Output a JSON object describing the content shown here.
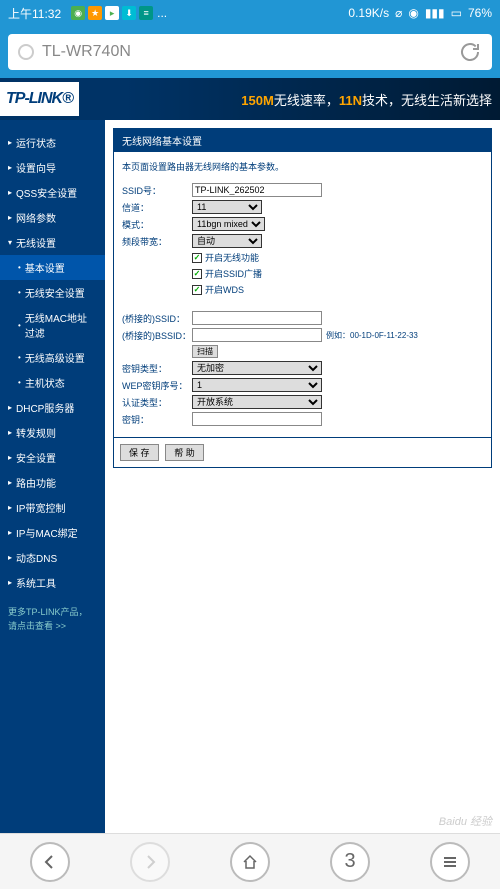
{
  "status": {
    "time": "上午11:32",
    "dots": "...",
    "speed": "0.19K/s",
    "battery": "76%"
  },
  "url": {
    "text": "TL-WR740N"
  },
  "banner": {
    "logo": "TP-LINK®",
    "slogan_hl1": "150M",
    "slogan_1": "无线速率，",
    "slogan_hl2": "11N",
    "slogan_2": "技术，无线生活新选择"
  },
  "nav": {
    "items": [
      {
        "label": "运行状态",
        "sub": false
      },
      {
        "label": "设置向导",
        "sub": false
      },
      {
        "label": "QSS安全设置",
        "sub": false
      },
      {
        "label": "网络参数",
        "sub": false
      },
      {
        "label": "无线设置",
        "sub": false,
        "expanded": true
      },
      {
        "label": "基本设置",
        "sub": true,
        "active": true
      },
      {
        "label": "无线安全设置",
        "sub": true
      },
      {
        "label": "无线MAC地址过滤",
        "sub": true
      },
      {
        "label": "无线高级设置",
        "sub": true
      },
      {
        "label": "主机状态",
        "sub": true
      },
      {
        "label": "DHCP服务器",
        "sub": false
      },
      {
        "label": "转发规则",
        "sub": false
      },
      {
        "label": "安全设置",
        "sub": false
      },
      {
        "label": "路由功能",
        "sub": false
      },
      {
        "label": "IP带宽控制",
        "sub": false
      },
      {
        "label": "IP与MAC绑定",
        "sub": false
      },
      {
        "label": "动态DNS",
        "sub": false
      },
      {
        "label": "系统工具",
        "sub": false
      }
    ],
    "promo1": "更多TP-LINK产品，",
    "promo2": "请点击查看 >>"
  },
  "panel": {
    "title": "无线网络基本设置",
    "desc": "本页面设置路由器无线网络的基本参数。",
    "ssid_label": "SSID号：",
    "ssid_value": "TP-LINK_262502",
    "channel_label": "信道：",
    "channel_value": "11",
    "mode_label": "模式：",
    "mode_value": "11bgn mixed",
    "bandwidth_label": "频段带宽：",
    "bandwidth_value": "自动",
    "chk1": "开启无线功能",
    "chk2": "开启SSID广播",
    "chk3": "开启WDS",
    "bridge_ssid_label": "(桥接的)SSID：",
    "bridge_ssid_value": "",
    "bridge_bssid_label": "(桥接的)BSSID：",
    "bridge_bssid_value": "",
    "bssid_note": "例如：00-1D-0F-11-22-33",
    "scan_btn": "扫描",
    "key_type_label": "密钥类型：",
    "key_type_value": "无加密",
    "wep_label": "WEP密钥序号：",
    "wep_value": "1",
    "auth_label": "认证类型：",
    "auth_value": "开放系统",
    "key_label": "密钥：",
    "key_value": "",
    "save": "保 存",
    "help": "帮 助"
  },
  "bottom": {
    "tabs": "3"
  },
  "watermark": "Baidu 经验"
}
